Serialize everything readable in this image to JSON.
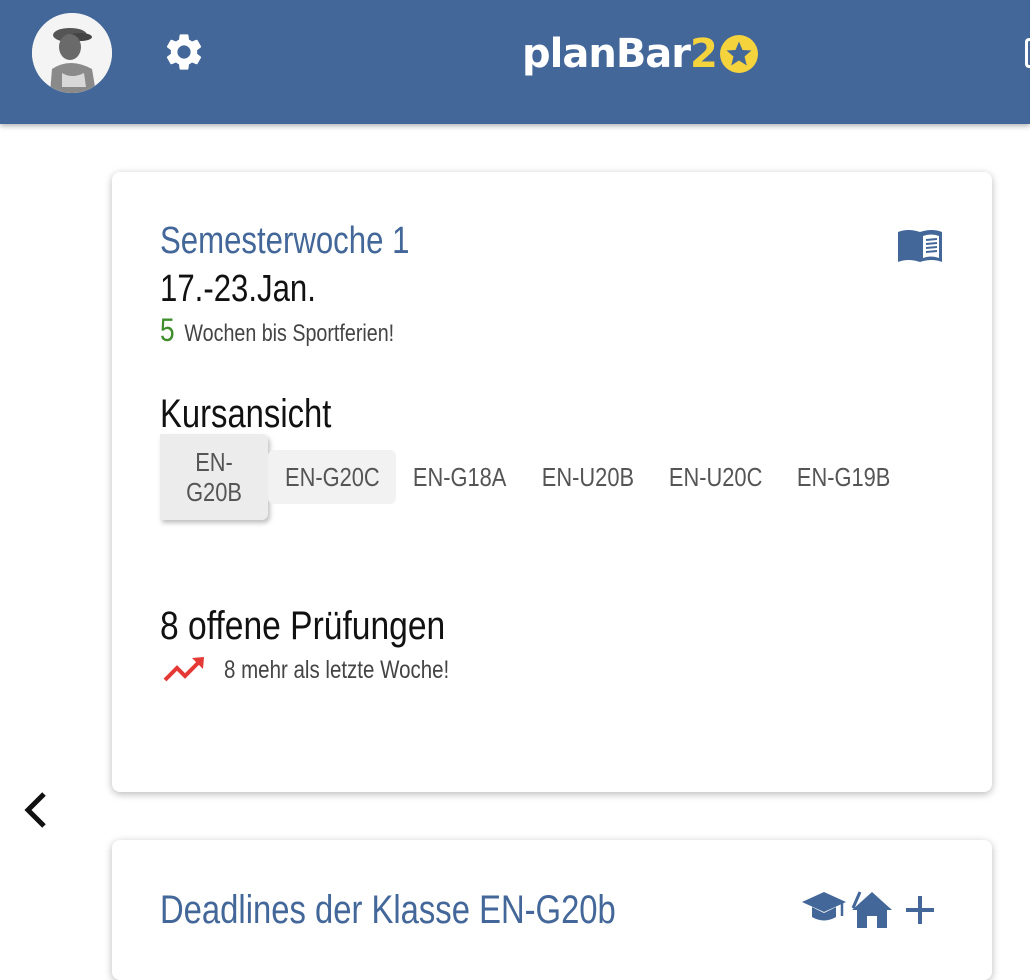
{
  "header": {
    "brand_main": "planBar",
    "brand_accent": "2",
    "colors": {
      "bar": "#436799",
      "accent": "#f5d33d"
    }
  },
  "week_card": {
    "title": "Semesterwoche 1",
    "date_range": "17.-23.Jan.",
    "countdown_number": "5",
    "countdown_text": "Wochen bis Sportferien!",
    "course_view_title": "Kursansicht",
    "tabs": [
      "EN-G20B",
      "EN-G20C",
      "EN-G18A",
      "EN-U20B",
      "EN-U20C",
      "EN-G19B"
    ],
    "active_tab": "EN-G20B",
    "exams_title": "8 offene Prüfungen",
    "exams_trend": "8 mehr als letzte Woche!"
  },
  "deadlines_card": {
    "title": "Deadlines der Klasse EN-G20b"
  },
  "icons": {
    "settings": "gear-icon",
    "book": "book-icon",
    "trend": "trending-up-icon",
    "back": "chevron-left-icon",
    "school": "graduation-cap-icon",
    "home": "home-icon",
    "add": "plus-icon"
  }
}
